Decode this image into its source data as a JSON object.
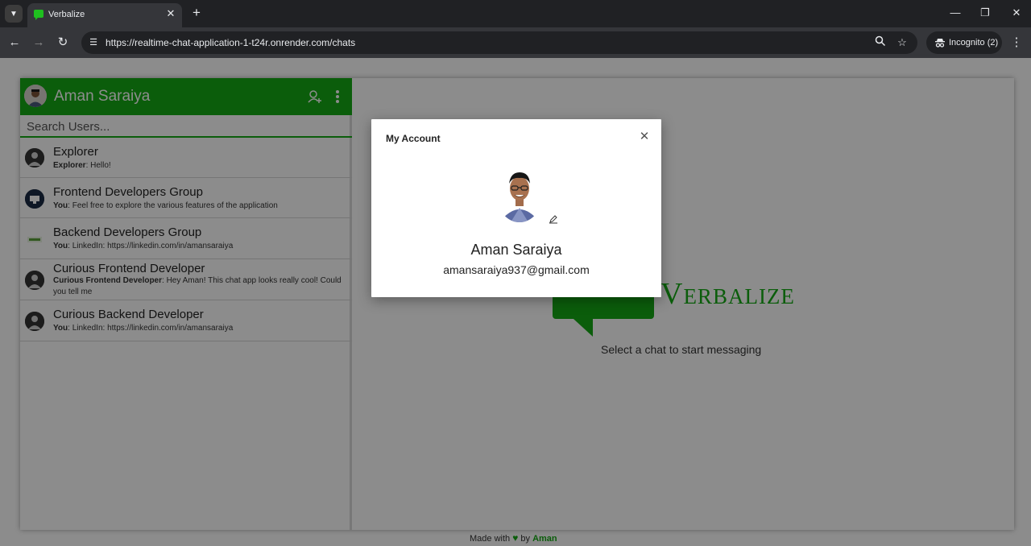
{
  "browser": {
    "tab_title": "Verbalize",
    "url": "https://realtime-chat-application-1-t24r.onrender.com/chats",
    "incognito_label": "Incognito (2)"
  },
  "sidebar": {
    "user_name": "Aman Saraiya",
    "search_placeholder": "Search Users...",
    "chats": [
      {
        "name": "Explorer",
        "sender": "Explorer",
        "message": ": Hello!"
      },
      {
        "name": "Frontend Developers Group",
        "sender": "You",
        "message": ": Feel free to explore the various features of the application"
      },
      {
        "name": "Backend Developers Group",
        "sender": "You",
        "message": ": LinkedIn: https://linkedin.com/in/amansaraiya"
      },
      {
        "name": "Curious Frontend Developer",
        "sender": "Curious Frontend Developer",
        "message": ": Hey Aman! This chat app looks really cool! Could you tell me"
      },
      {
        "name": "Curious Backend Developer",
        "sender": "You",
        "message": ": LinkedIn: https://linkedin.com/in/amansaraiya"
      }
    ]
  },
  "main": {
    "logo_text": "Verbalize",
    "select_message": "Select a chat to start messaging"
  },
  "footer": {
    "made_with": "Made with",
    "by": "by",
    "author": "Aman"
  },
  "modal": {
    "title": "My Account",
    "name": "Aman Saraiya",
    "email": "amansaraiya937@gmail.com"
  },
  "colors": {
    "accent": "#15a915",
    "overlay": "rgba(0,0,0,0.45)"
  }
}
